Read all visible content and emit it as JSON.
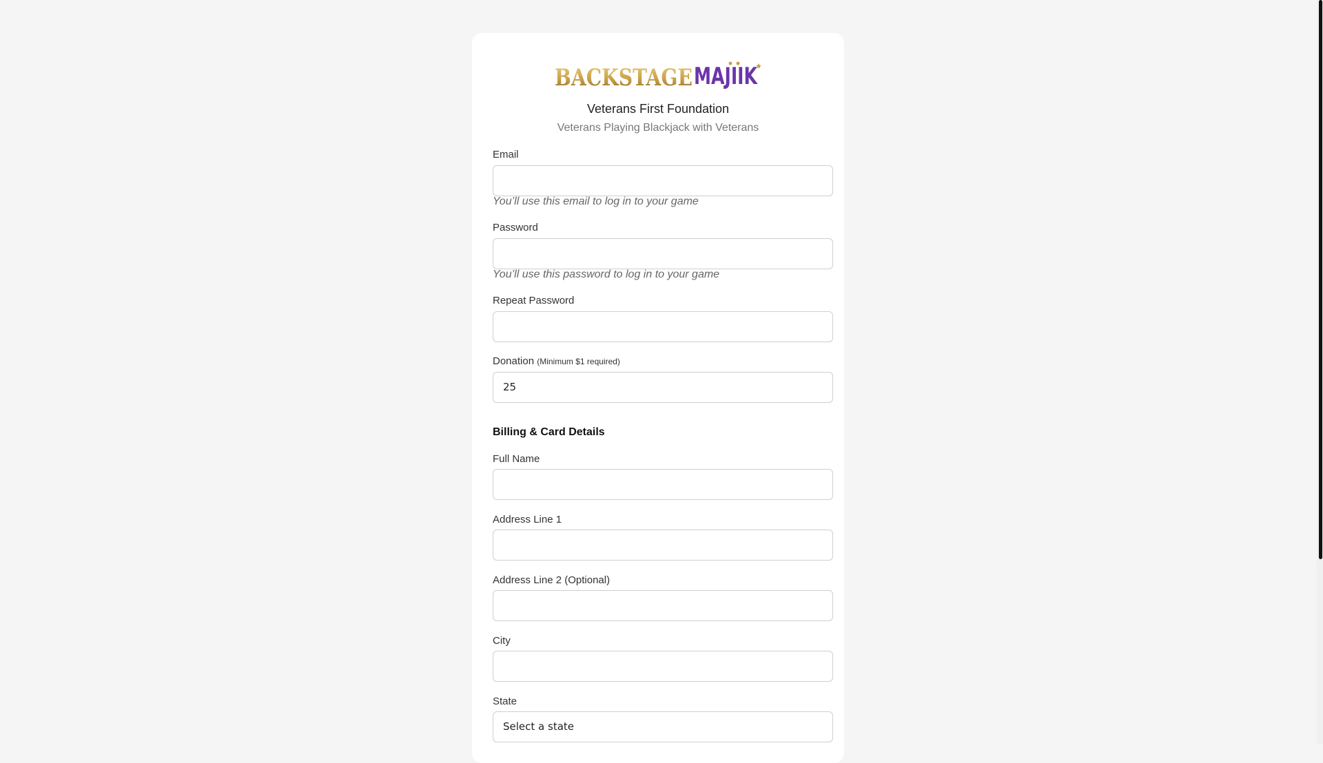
{
  "brand": {
    "logo_part1": "BACKSTAGE",
    "logo_part2": "MAJIIK",
    "logo_colors": {
      "gold": "#c9a046",
      "purple": "#6b35a8"
    }
  },
  "header": {
    "title": "Veterans First Foundation",
    "subtitle": "Veterans Playing Blackjack with Veterans"
  },
  "form": {
    "email": {
      "label": "Email",
      "value": "",
      "help": "You’ll use this email to log in to your game"
    },
    "password": {
      "label": "Password",
      "value": "",
      "help": "You’ll use this password to log in to your game"
    },
    "repeat_password": {
      "label": "Repeat Password",
      "value": ""
    },
    "donation": {
      "label": "Donation",
      "note": "(Minimum $1 required)",
      "value": "25"
    },
    "billing_heading": "Billing & Card Details",
    "full_name": {
      "label": "Full Name",
      "value": ""
    },
    "address1": {
      "label": "Address Line 1",
      "value": ""
    },
    "address2": {
      "label": "Address Line 2 (Optional)",
      "value": ""
    },
    "city": {
      "label": "City",
      "value": ""
    },
    "state": {
      "label": "State",
      "selected": "Select a state"
    }
  }
}
